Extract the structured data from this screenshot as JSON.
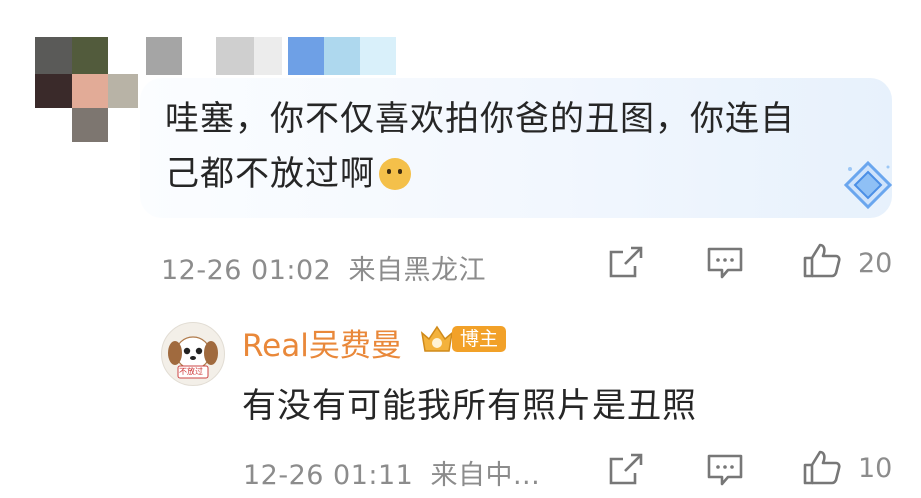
{
  "comment": {
    "text_line1": "哇塞，你不仅喜欢拍你爸的丑图，你连自",
    "text_line2": "己都不放过啊",
    "emoji": "doge-emoji",
    "time": "12-26 01:02",
    "location": "来自黑龙江",
    "like_count": "20",
    "icons": [
      "share-icon",
      "comment-icon",
      "like-icon"
    ]
  },
  "reply": {
    "author": "Real吴费曼",
    "badge_label": "博主",
    "avatar_label": "不放过",
    "text": "有没有可能我所有照片是丑照",
    "time": "12-26 01:11",
    "location": "来自中...",
    "like_count": "10",
    "icons": [
      "share-icon",
      "comment-icon",
      "like-icon"
    ]
  },
  "colors": {
    "accent_name": "#e9883a",
    "badge_bg": "#f2a128",
    "meta_text": "#8c8c8c",
    "bubble_tint": "#e7f1fc"
  }
}
